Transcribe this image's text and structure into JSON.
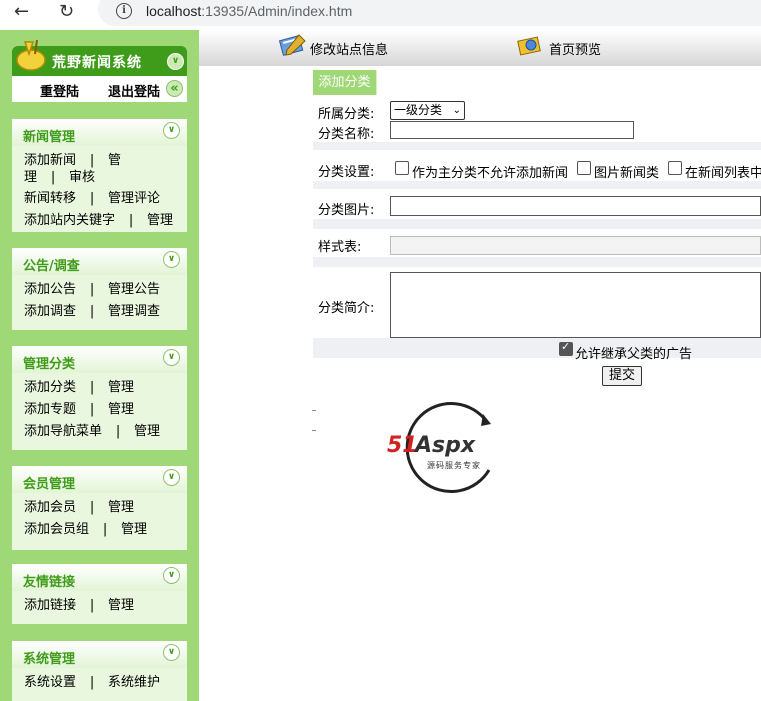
{
  "browser": {
    "url_host": "localhost",
    "url_rest": ":13935/Admin/index.htm"
  },
  "sidebar": {
    "logo_title": "荒野新闻系统",
    "relogin": "重登陆",
    "logout": "退出登陆",
    "sections": [
      {
        "title": "新闻管理",
        "lines": [
          [
            "添加新闻",
            "|",
            "管"
          ],
          [
            "理",
            "|",
            "审核"
          ],
          [
            "新闻转移",
            "|",
            "管理评论"
          ],
          [
            "添加站内关键字",
            "|",
            "管理"
          ]
        ]
      },
      {
        "title": "公告/调查",
        "lines": [
          [
            "添加公告",
            "|",
            "管理公告"
          ],
          [
            "添加调查",
            "|",
            "管理调查"
          ]
        ]
      },
      {
        "title": "管理分类",
        "lines": [
          [
            "添加分类",
            "|",
            "管理"
          ],
          [
            "添加专题",
            "|",
            "管理"
          ],
          [
            "添加导航菜单",
            "|",
            "管理"
          ]
        ]
      },
      {
        "title": "会员管理",
        "lines": [
          [
            "添加会员",
            "|",
            "管理"
          ],
          [
            "添加会员组",
            "|",
            "管理"
          ]
        ]
      },
      {
        "title": "友情链接",
        "lines": [
          [
            "添加链接",
            "|",
            "管理"
          ]
        ]
      },
      {
        "title": "系统管理",
        "lines": [
          [
            "系统设置",
            "|",
            "系统维护"
          ]
        ]
      }
    ]
  },
  "topbar": {
    "edit_site": "修改站点信息",
    "home_preview": "首页预览"
  },
  "form": {
    "tab_title": "添加分类",
    "parent_label": "所属分类:",
    "parent_value": "一级分类",
    "name_label": "分类名称:",
    "name_value": "",
    "settings_label": "分类设置:",
    "opt_main": "作为主分类不允许添加新闻",
    "opt_image": "图片新闻类",
    "opt_list": "在新闻列表中",
    "image_label": "分类图片:",
    "image_value": "",
    "style_label": "样式表:",
    "intro_label": "分类简介:",
    "inherit_ads": "允许继承父类的广告",
    "submit": "提交"
  },
  "watermark": {
    "brand_red": "51",
    "brand_dark": "Aspx",
    "tagline": "源码服务专家"
  },
  "colors": {
    "sidebar_green": "#9fd877",
    "logo_green": "#3f9c1a",
    "menu_title_green": "#3f9c1a"
  }
}
